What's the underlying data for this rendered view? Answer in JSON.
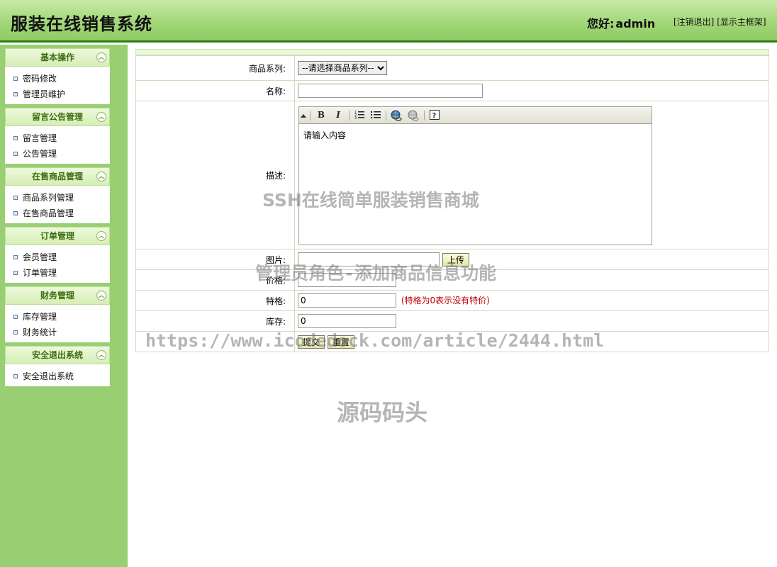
{
  "header": {
    "title": "服装在线销售系统",
    "greeting": "您好:",
    "username": "admin",
    "logout_link": "[注销退出]",
    "frame_link": "[显示主框架]"
  },
  "sidebar": {
    "groups": [
      {
        "title": "基本操作",
        "items": [
          "密码修改",
          "管理员维护"
        ]
      },
      {
        "title": "留言公告管理",
        "items": [
          "留言管理",
          "公告管理"
        ]
      },
      {
        "title": "在售商品管理",
        "items": [
          "商品系列管理",
          "在售商品管理"
        ]
      },
      {
        "title": "订单管理",
        "items": [
          "会员管理",
          "订单管理"
        ]
      },
      {
        "title": "财务管理",
        "items": [
          "库存管理",
          "财务统计"
        ]
      },
      {
        "title": "安全退出系统",
        "items": [
          "安全退出系统"
        ]
      }
    ]
  },
  "form": {
    "category_label": "商品系列:",
    "category_selected": "--请选择商品系列--",
    "name_label": "名称:",
    "name_value": "",
    "desc_label": "描述:",
    "desc_content": "请输入内容",
    "image_label": "图片:",
    "image_value": "",
    "upload_button": "上传",
    "price_label": "价格:",
    "price_value": "",
    "special_label": "特格:",
    "special_value": "0",
    "special_hint": "(特格为0表示没有特价)",
    "stock_label": "库存:",
    "stock_value": "0",
    "submit_button": "提交",
    "reset_button": "重置"
  },
  "editor_toolbar": [
    "bold-icon",
    "italic-icon",
    "ordered-list-icon",
    "unordered-list-icon",
    "link-icon",
    "unlink-icon",
    "help-icon"
  ],
  "watermarks": {
    "line1": "SSH在线简单服装销售商城",
    "line2": "管理员角色-添加商品信息功能",
    "line3": "https://www.icodedock.com/article/2444.html",
    "line4": "源码码头"
  },
  "colors": {
    "header_green": "#a3d77a",
    "sidebar_green": "#98cf73",
    "hint_red": "#c00000"
  }
}
